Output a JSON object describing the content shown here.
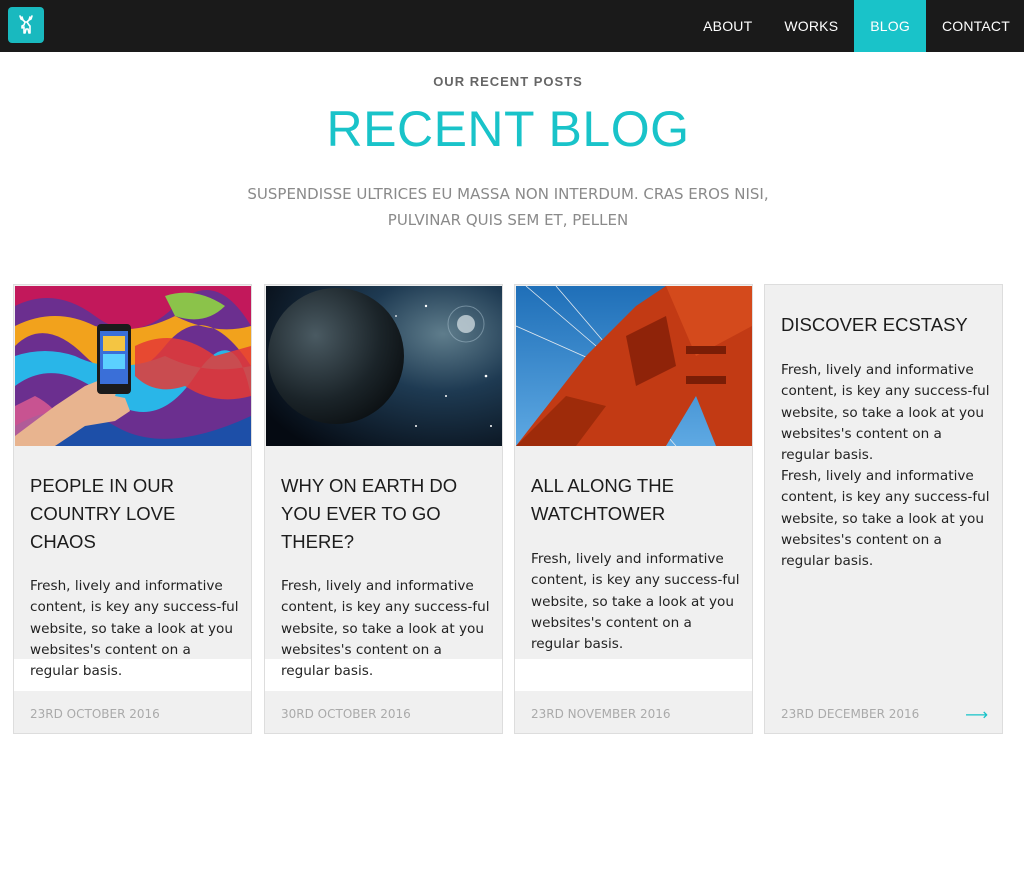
{
  "colors": {
    "accent": "#19c3c9",
    "navbar": "#1a1a1a",
    "card_bg": "#f0f0f0"
  },
  "logo": {
    "icon": "deer-icon"
  },
  "nav": [
    {
      "label": "ABOUT",
      "active": false
    },
    {
      "label": "WORKS",
      "active": false
    },
    {
      "label": "BLOG",
      "active": true
    },
    {
      "label": "CONTACT",
      "active": false
    }
  ],
  "header": {
    "kicker": "OUR RECENT POSTS",
    "title": "RECENT BLOG",
    "subtitle_line1": "SUSPENDISSE ULTRICES EU MASSA NON INTERDUM. CRAS EROS NISI,",
    "subtitle_line2": "PULVINAR QUIS SEM ET, PELLEN"
  },
  "posts": [
    {
      "image": "graffiti-phone-photo",
      "title_lines": [
        "PEOPLE IN OUR",
        "COUNTRY LOVE",
        "CHAOS"
      ],
      "excerpt": "Fresh, lively and informative content, is key any success-ful website, so take a look at you websites's content on a regular basis.",
      "date": "23RD OCTOBER 2016"
    },
    {
      "image": "planet-space-photo",
      "title_lines": [
        "WHY ON EARTH DO",
        "YOU EVER TO GO",
        "THERE?"
      ],
      "excerpt": "Fresh, lively and informative content, is key any success-ful website, so take a look at you websites's content on a regular basis.",
      "date": "30RD OCTOBER 2016"
    },
    {
      "image": "golden-gate-bridge-photo",
      "title_lines": [
        "ALL ALONG THE",
        "WATCHTOWER"
      ],
      "excerpt": "Fresh, lively and informative content, is key any success-ful website, so take a look at you websites's content on a regular basis.",
      "date": "23RD NOVEMBER 2016"
    },
    {
      "title_lines": [
        "DISCOVER ECSTASY"
      ],
      "excerpt": "Fresh, lively and informative content, is key any success-ful website, so take a look at you websites's content on a regular basis.",
      "excerpt2": "Fresh, lively and informative content, is key any success-ful website, so take a look at you websites's content on a regular basis.",
      "date": "23RD DECEMBER 2016",
      "arrow_icon": "arrow-right-icon"
    }
  ]
}
